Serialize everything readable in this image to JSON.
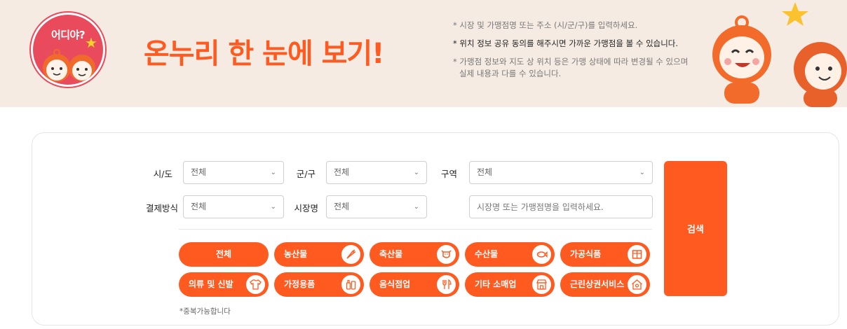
{
  "banner": {
    "badge_text": "어디야?",
    "title": "온누리 한 눈에 보기!",
    "notes": [
      "* 시장 및 가맹점명 또는 주소 (시/군/구)를 입력하세요.",
      "* 위치 정보 공유 동의를 해주시면 가까운 가맹점을 볼 수 있습니다.",
      "* 가맹점 정보와 지도 상 위치 등은 가맹 상태에 따라 변경될 수 있으며 실제 내용과 다를 수 있습니다."
    ]
  },
  "filters": {
    "sido": {
      "label": "시/도",
      "value": "전체"
    },
    "gungu": {
      "label": "군/구",
      "value": "전체"
    },
    "area": {
      "label": "구역",
      "value": "전체"
    },
    "payment": {
      "label": "결제방식",
      "value": "전체"
    },
    "market": {
      "label": "시장명",
      "value": "전체"
    },
    "keyword": {
      "placeholder": "시장명 또는 가맹점명을 입력하세요."
    },
    "search_label": "검색"
  },
  "categories": [
    {
      "label": "전체",
      "icon": "none"
    },
    {
      "label": "농산물",
      "icon": "carrot-icon"
    },
    {
      "label": "축산물",
      "icon": "cow-icon"
    },
    {
      "label": "수산물",
      "icon": "fish-icon"
    },
    {
      "label": "가공식품",
      "icon": "package-icon"
    },
    {
      "label": "의류 및 신발",
      "icon": "shirt-icon"
    },
    {
      "label": "가정용품",
      "icon": "bottles-icon"
    },
    {
      "label": "음식점업",
      "icon": "utensils-icon"
    },
    {
      "label": "기타 소매업",
      "icon": "storefront-icon"
    },
    {
      "label": "근린상권서비스",
      "icon": "house-pin-icon"
    }
  ],
  "footnote": "*중복가능합니다",
  "colors": {
    "accent": "#ff5a1f",
    "banner_bg": "#f5ebe3",
    "badge": "#e94b5c"
  }
}
